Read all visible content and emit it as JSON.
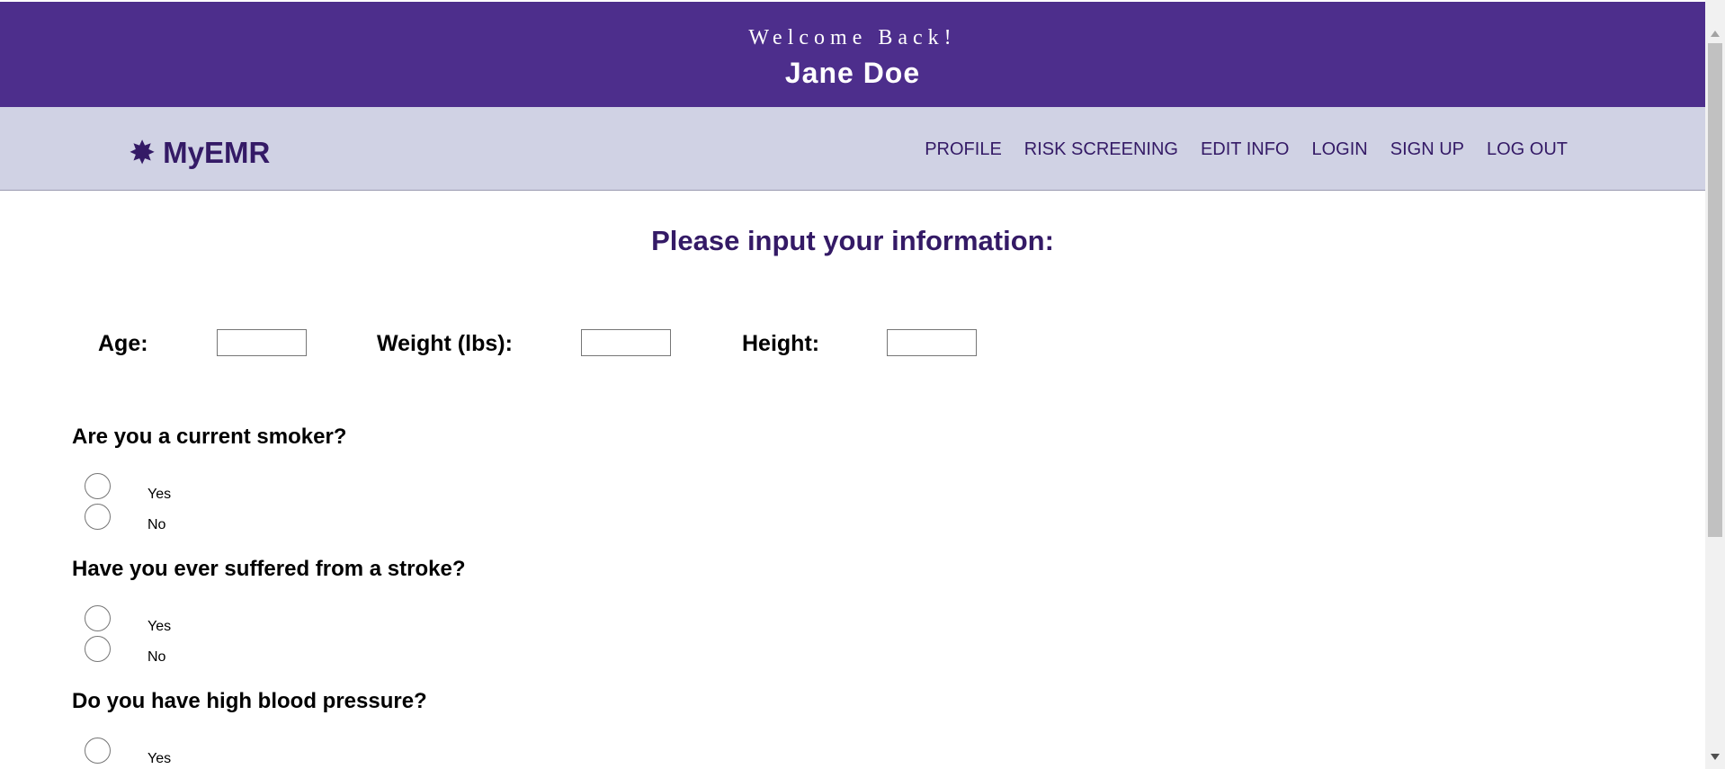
{
  "header": {
    "welcome": "Welcome Back!",
    "user_name": "Jane Doe",
    "background_color": "#4d2e8c"
  },
  "nav": {
    "brand_icon": "starburst-icon",
    "brand_glyph": "✸",
    "brand": "MyEMR",
    "links": [
      "PROFILE",
      "RISK SCREENING",
      "EDIT INFO",
      "LOGIN",
      "SIGN UP",
      "LOG OUT"
    ],
    "background_color": "#d0d2e4",
    "text_color": "#341a66"
  },
  "form": {
    "title": "Please input your information:",
    "fields": [
      {
        "label": "Age:",
        "value": ""
      },
      {
        "label": "Weight (lbs):",
        "value": ""
      },
      {
        "label": "Height:",
        "value": ""
      }
    ],
    "questions": [
      {
        "text": "Are you a current smoker?",
        "options": [
          "Yes",
          "No"
        ]
      },
      {
        "text": "Have you ever suffered from a stroke?",
        "options": [
          "Yes",
          "No"
        ]
      },
      {
        "text": "Do you have high blood pressure?",
        "options": [
          "Yes"
        ]
      }
    ]
  }
}
